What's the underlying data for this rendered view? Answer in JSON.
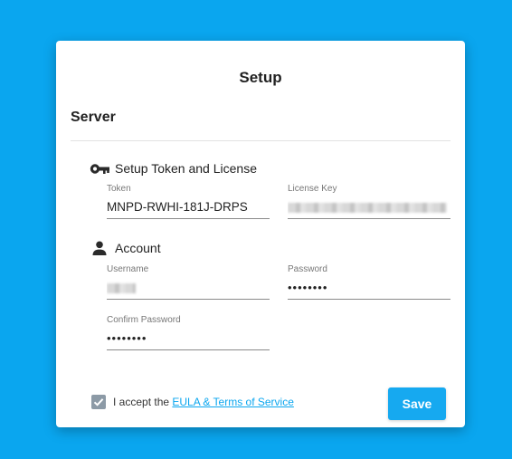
{
  "dialog": {
    "title": "Setup",
    "section_title": "Server",
    "license_group": {
      "heading": "Setup Token and License",
      "icon": "key-icon",
      "token_label": "Token",
      "token_value": "MNPD-RWHI-181J-DRPS",
      "license_label": "License Key",
      "license_value_redacted": true
    },
    "account_group": {
      "heading": "Account",
      "icon": "person-icon",
      "username_label": "Username",
      "username_value_redacted": true,
      "password_label": "Password",
      "password_value": "••••••••",
      "confirm_label": "Confirm Password",
      "confirm_value": "••••••••"
    },
    "terms": {
      "checked": true,
      "prefix": "I accept the",
      "link_text": "EULA & Terms of Service"
    },
    "save_label": "Save"
  },
  "colors": {
    "background": "#0aa6ef",
    "accent": "#16a9f0",
    "checkbox": "#8c9aa6"
  }
}
